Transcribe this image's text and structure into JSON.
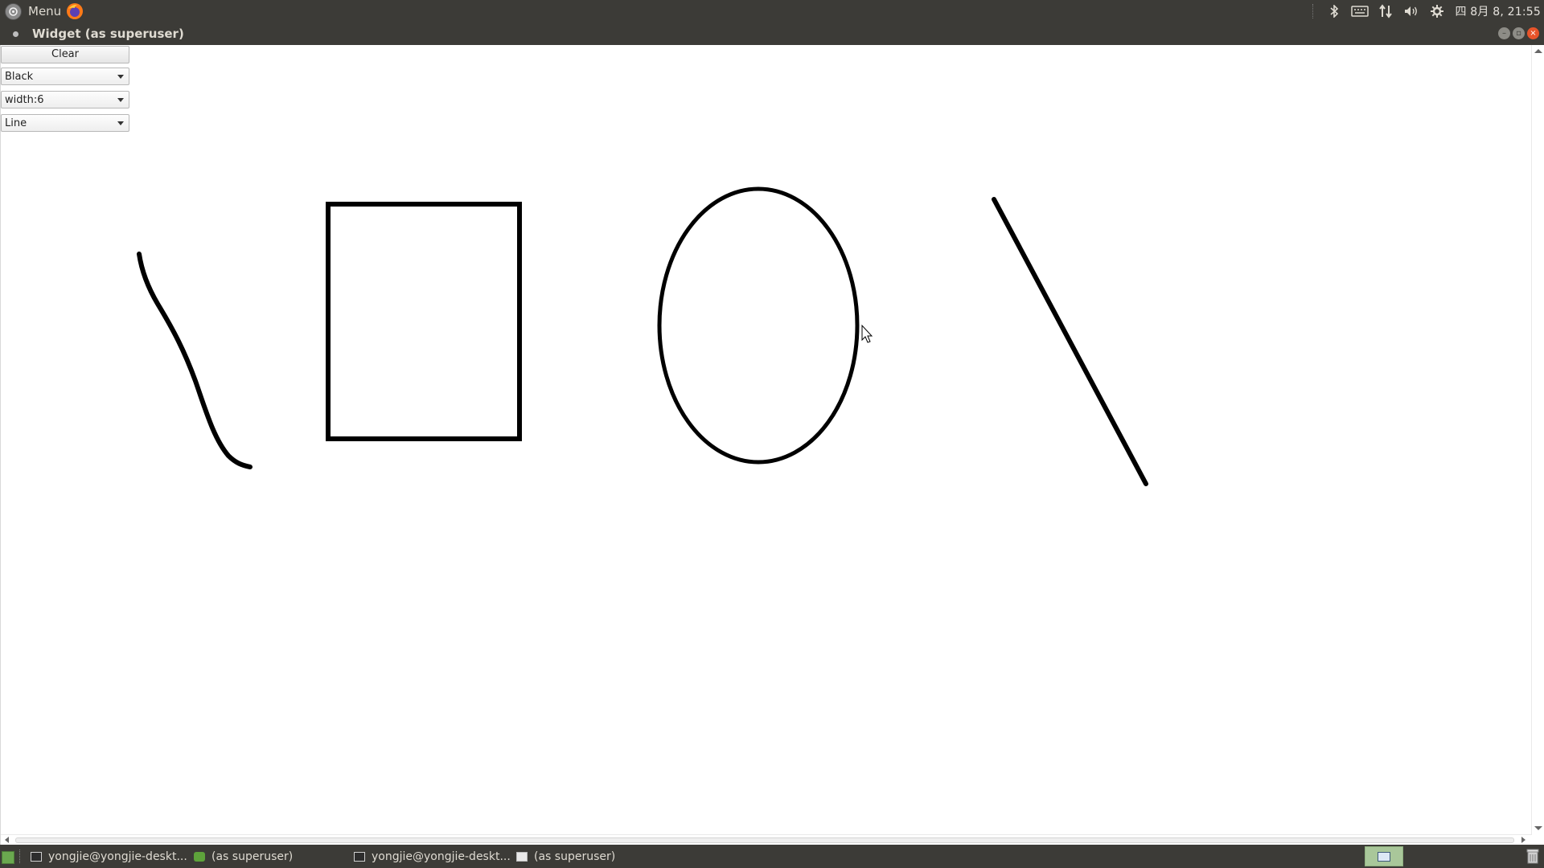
{
  "top_panel": {
    "menu_label": "Menu",
    "icons": [
      "menu-logo-icon",
      "firefox-icon",
      "bluetooth-icon",
      "keyboard-icon",
      "network-icon",
      "volume-icon",
      "settings-icon"
    ],
    "clock": "四 8月  8, 21:55"
  },
  "window": {
    "title": "Widget (as superuser)",
    "colors": {
      "titlebar": "#3c3b37",
      "close_button": "#e8542a"
    }
  },
  "controls": {
    "clear_label": "Clear",
    "color_select": {
      "value": "Black"
    },
    "width_select": {
      "value": "width:6"
    },
    "shape_select": {
      "value": "Line"
    }
  },
  "drawing": {
    "stroke_color": "#000000",
    "stroke_width": 6,
    "shapes": [
      "freehand-stroke",
      "rectangle",
      "ellipse",
      "straight-line"
    ]
  },
  "taskbar": {
    "tasks": [
      {
        "label": "yongjie@yongjie-deskt...",
        "icon": "terminal-icon"
      },
      {
        "label": "(as superuser)",
        "icon": "green-app-icon"
      },
      {
        "label": "yongjie@yongjie-deskt...",
        "icon": "terminal-icon"
      },
      {
        "label": "(as superuser)",
        "icon": "window-icon"
      }
    ],
    "workspace_color": "#a9c79a"
  }
}
